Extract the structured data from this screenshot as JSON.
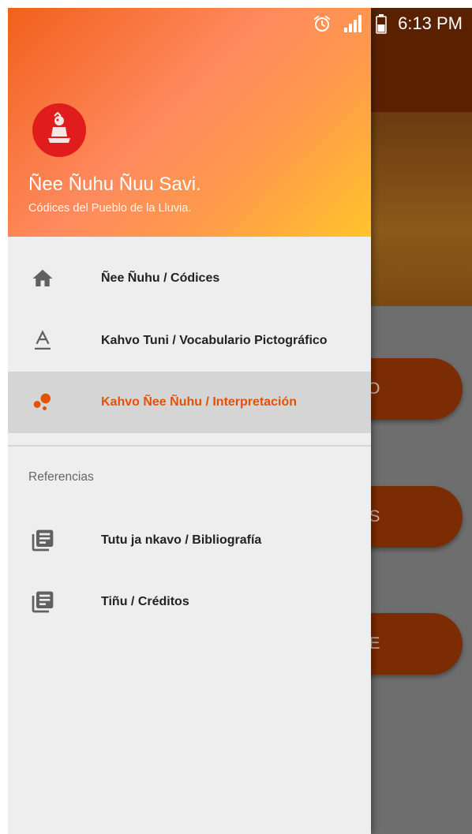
{
  "status_bar": {
    "time": "6:13 PM"
  },
  "drawer": {
    "header": {
      "title": "Ñee Ñuhu Ñuu Savi.",
      "subtitle": "Códices del Pueblo de la Lluvia."
    },
    "items": [
      {
        "label": "Ñee Ñuhu / Códices",
        "icon": "home-icon"
      },
      {
        "label": "Kahvo Tuni / Vocabulario Pictográfico",
        "icon": "text-format-icon"
      },
      {
        "label": "Kahvo Ñee Ñuhu / Interpretación",
        "icon": "bubbles-icon",
        "active": true
      }
    ],
    "section_label": "Referencias",
    "reference_items": [
      {
        "label": "Tutu ja nkavo / Bibliografía",
        "icon": "library-books-icon"
      },
      {
        "label": "Tiñu / Créditos",
        "icon": "library-books-icon"
      }
    ]
  },
  "background": {
    "buttons": [
      {
        "label": "CO"
      },
      {
        "label": "DICES"
      },
      {
        "label": "ICE"
      }
    ]
  },
  "colors": {
    "accent": "#e65100",
    "header_gradient_start": "#f2601c",
    "header_gradient_end": "#ffc52a",
    "avatar_bg": "#e11c1c",
    "active_item_bg": "#d5d5d5"
  }
}
